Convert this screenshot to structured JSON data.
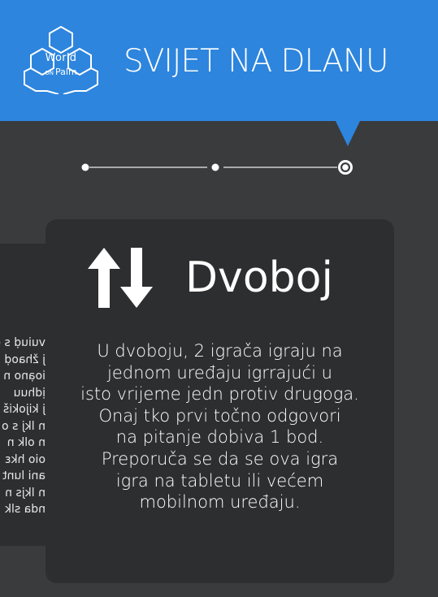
{
  "header": {
    "logo": {
      "line1": "World",
      "line2_small": "ON",
      "line2": "Palm"
    },
    "title": "SVIJET NA DLANU",
    "accent_color": "#2d85dd"
  },
  "stepper": {
    "steps": 3,
    "current_step": 3
  },
  "side_card": {
    "lines": [
      "vuiuḍ s duiu",
      "j žhaoḍ",
      "ioạno n",
      "ịdhuu",
      "j kijokiš",
      "n lkj s o",
      "n olk n",
      "oio hkɛ",
      "ani lunt",
      "n lkjs n",
      "nda slk"
    ]
  },
  "card": {
    "icon": "up-down-arrows-icon",
    "title": "Dvoboj",
    "body_lines": [
      "U dvoboju, 2 igrača igraju na",
      "jednom uređaju igrrajući u",
      "isto vrijeme jedn protiv drugoga.",
      "Onaj tko prvi točno odgovori",
      "na pitanje dobiva 1 bod.",
      "Preporuča se da se ova igra",
      "igra na tabletu ili većem",
      "mobilnom uređaju."
    ]
  }
}
